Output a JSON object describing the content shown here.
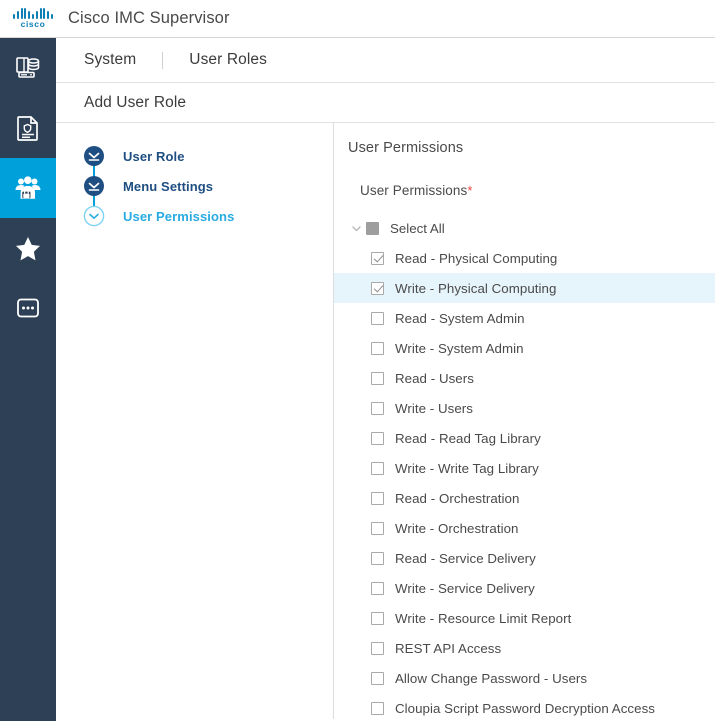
{
  "topbar": {
    "brand_wordmark": "cisco",
    "app_title": "Cisco IMC Supervisor",
    "brand_color": "#0d7fb5"
  },
  "rail": {
    "background": "#2e4055",
    "active_color": "#00a0da",
    "items": [
      {
        "icon": "server-storage-icon",
        "active": false
      },
      {
        "icon": "policy-document-icon",
        "active": false
      },
      {
        "icon": "user-group-lock-icon",
        "active": true
      },
      {
        "icon": "star-icon",
        "active": false
      },
      {
        "icon": "more-options-icon",
        "active": false
      }
    ]
  },
  "breadcrumb": {
    "items": [
      {
        "label": "System"
      },
      {
        "label": "User Roles"
      }
    ]
  },
  "page": {
    "title": "Add User Role"
  },
  "wizard": {
    "steps": [
      {
        "label": "User Role",
        "state": "completed"
      },
      {
        "label": "Menu Settings",
        "state": "completed"
      },
      {
        "label": "User Permissions",
        "state": "current"
      }
    ]
  },
  "permissions": {
    "heading": "User Permissions",
    "field_label": "User Permissions",
    "required_marker": "*",
    "required_color": "#e8433c",
    "select_all": {
      "label": "Select All",
      "state": "indeterminate",
      "toggle_icon": "chevron-down-icon"
    },
    "selected_row_color": "#e6f4fb",
    "items": [
      {
        "label": "Read - Physical Computing",
        "checked": true,
        "selected": false
      },
      {
        "label": "Write - Physical Computing",
        "checked": true,
        "selected": true
      },
      {
        "label": "Read - System Admin",
        "checked": false,
        "selected": false
      },
      {
        "label": "Write - System Admin",
        "checked": false,
        "selected": false
      },
      {
        "label": "Read - Users",
        "checked": false,
        "selected": false
      },
      {
        "label": "Write - Users",
        "checked": false,
        "selected": false
      },
      {
        "label": "Read - Read Tag Library",
        "checked": false,
        "selected": false
      },
      {
        "label": "Write - Write Tag Library",
        "checked": false,
        "selected": false
      },
      {
        "label": "Read - Orchestration",
        "checked": false,
        "selected": false
      },
      {
        "label": "Write - Orchestration",
        "checked": false,
        "selected": false
      },
      {
        "label": "Read - Service Delivery",
        "checked": false,
        "selected": false
      },
      {
        "label": "Write - Service Delivery",
        "checked": false,
        "selected": false
      },
      {
        "label": "Write - Resource Limit Report",
        "checked": false,
        "selected": false
      },
      {
        "label": "REST API Access",
        "checked": false,
        "selected": false
      },
      {
        "label": "Allow Change Password - Users",
        "checked": false,
        "selected": false
      },
      {
        "label": "Cloupia Script Password Decryption Access",
        "checked": false,
        "selected": false
      }
    ]
  }
}
